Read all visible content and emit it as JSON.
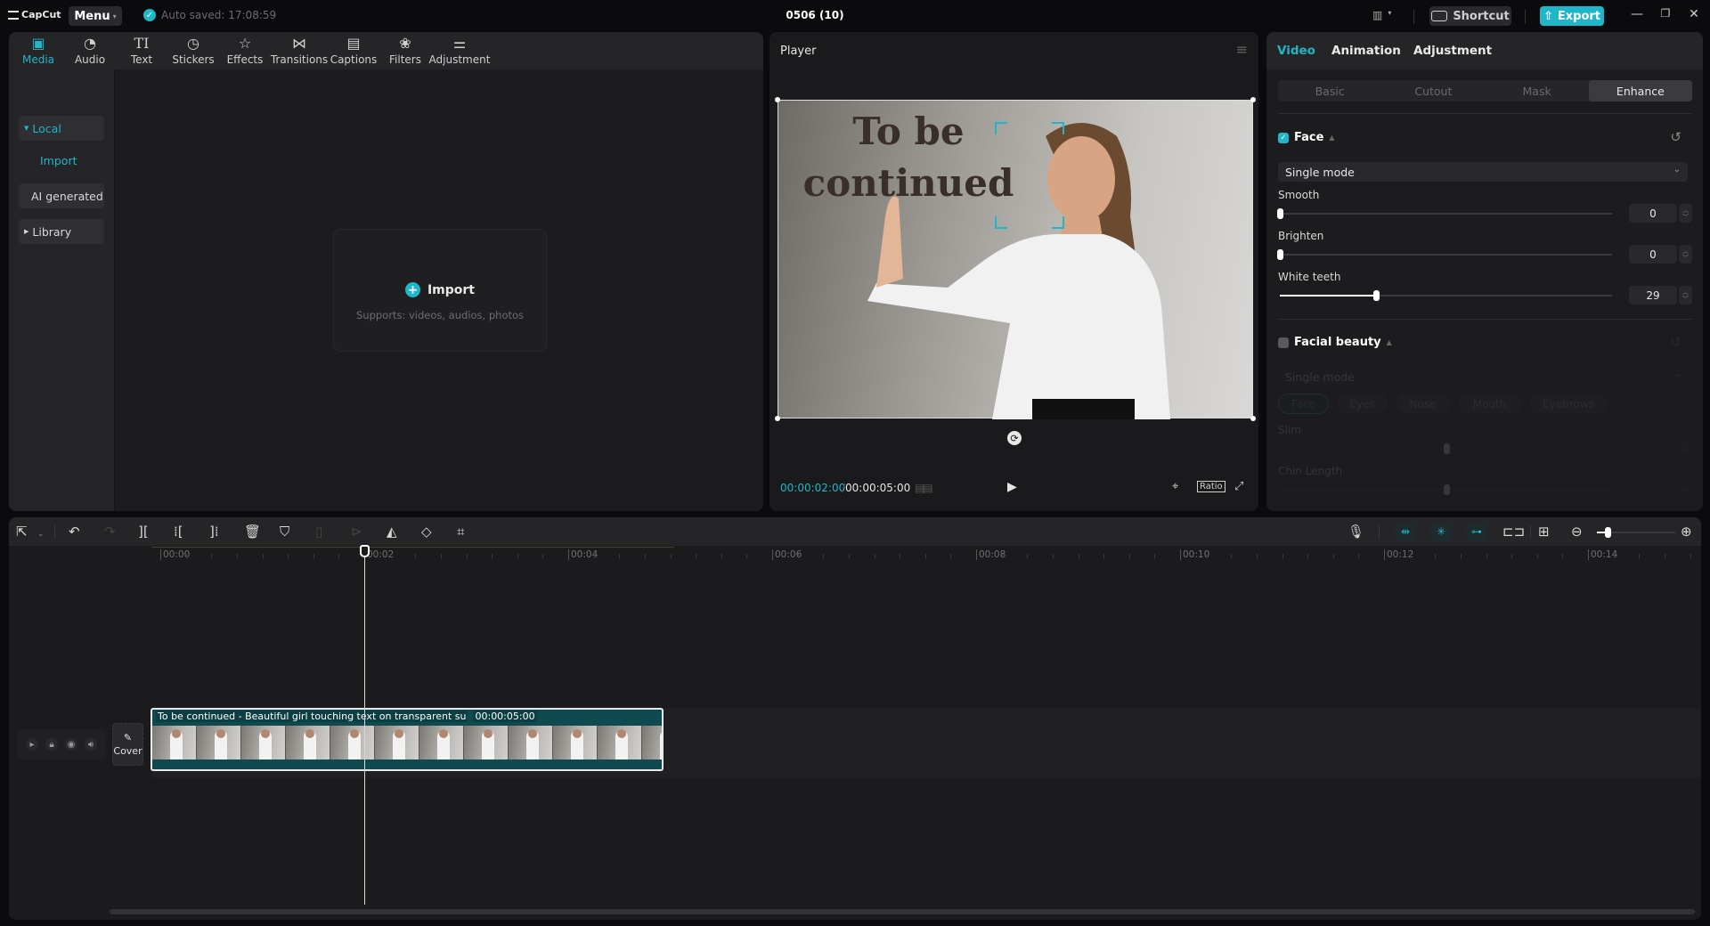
{
  "app": {
    "logo": "CapCut",
    "menu_label": "Menu",
    "autosave_text": "Auto saved: 17:08:59",
    "project_title": "0506 (10)",
    "shortcut_label": "Shortcut",
    "export_label": "Export",
    "window_controls": [
      "minimize",
      "restore",
      "close"
    ]
  },
  "media_toolbar": {
    "tools": [
      {
        "label": "Media",
        "icon": "media-icon",
        "active": true
      },
      {
        "label": "Audio",
        "icon": "audio-icon",
        "active": false
      },
      {
        "label": "Text",
        "icon": "text-icon",
        "active": false
      },
      {
        "label": "Stickers",
        "icon": "stickers-icon",
        "active": false
      },
      {
        "label": "Effects",
        "icon": "effects-icon",
        "active": false
      },
      {
        "label": "Transitions",
        "icon": "transitions-icon",
        "active": false
      },
      {
        "label": "Captions",
        "icon": "captions-icon",
        "active": false
      },
      {
        "label": "Filters",
        "icon": "filters-icon",
        "active": false
      },
      {
        "label": "Adjustment",
        "icon": "adjustment-icon",
        "active": false
      }
    ]
  },
  "media_sidebar": {
    "items": [
      {
        "label": "Local",
        "expanded": true
      },
      {
        "label": "Import"
      },
      {
        "label": "AI generated"
      },
      {
        "label": "Library",
        "expanded": false
      }
    ]
  },
  "import_area": {
    "title": "Import",
    "subtitle": "Supports: videos, audios, photos"
  },
  "player": {
    "title": "Player",
    "video_text": "To be continued",
    "current_time": "00:00:02:00",
    "total_time": "00:00:05:00",
    "ratio_label": "Ratio"
  },
  "properties": {
    "tabs": [
      {
        "label": "Video",
        "active": true
      },
      {
        "label": "Animation",
        "active": false
      },
      {
        "label": "Adjustment",
        "active": false
      }
    ],
    "subtabs": [
      {
        "label": "Basic",
        "active": false
      },
      {
        "label": "Cutout",
        "active": false
      },
      {
        "label": "Mask",
        "active": false
      },
      {
        "label": "Enhance",
        "active": true
      }
    ],
    "face": {
      "title": "Face",
      "enabled": true,
      "mode": "Single mode",
      "sliders": [
        {
          "label": "Smooth",
          "value": 0,
          "max": 100
        },
        {
          "label": "Brighten",
          "value": 0,
          "max": 100
        },
        {
          "label": "White teeth",
          "value": 29,
          "max": 100
        }
      ]
    },
    "facial_beauty": {
      "title": "Facial beauty",
      "enabled": false,
      "mode": "Single mode",
      "chips": [
        "Face",
        "Eyes",
        "Nose",
        "Mouth",
        "Eyebrows"
      ],
      "sliders": [
        {
          "label": "Slim",
          "value": 50,
          "max": 100
        },
        {
          "label": "Chin Length",
          "value": 50,
          "max": 100
        }
      ]
    }
  },
  "timeline": {
    "ruler_labels": [
      "00:00",
      "00:02",
      "00:04",
      "00:06",
      "00:08",
      "00:10",
      "00:12",
      "00:14"
    ],
    "playhead_seconds": 2,
    "cover_label": "Cover",
    "clip": {
      "name": "To be continued - Beautiful girl touching text on transparent su",
      "duration": "00:00:05:00",
      "start_seconds": 0,
      "length_seconds": 5
    },
    "zoom_level": 0.1
  },
  "colors": {
    "accent": "#1fb6c9",
    "background": "#0b0b0d",
    "panel": "#1c1c1e",
    "clip": "#0e4a50"
  }
}
